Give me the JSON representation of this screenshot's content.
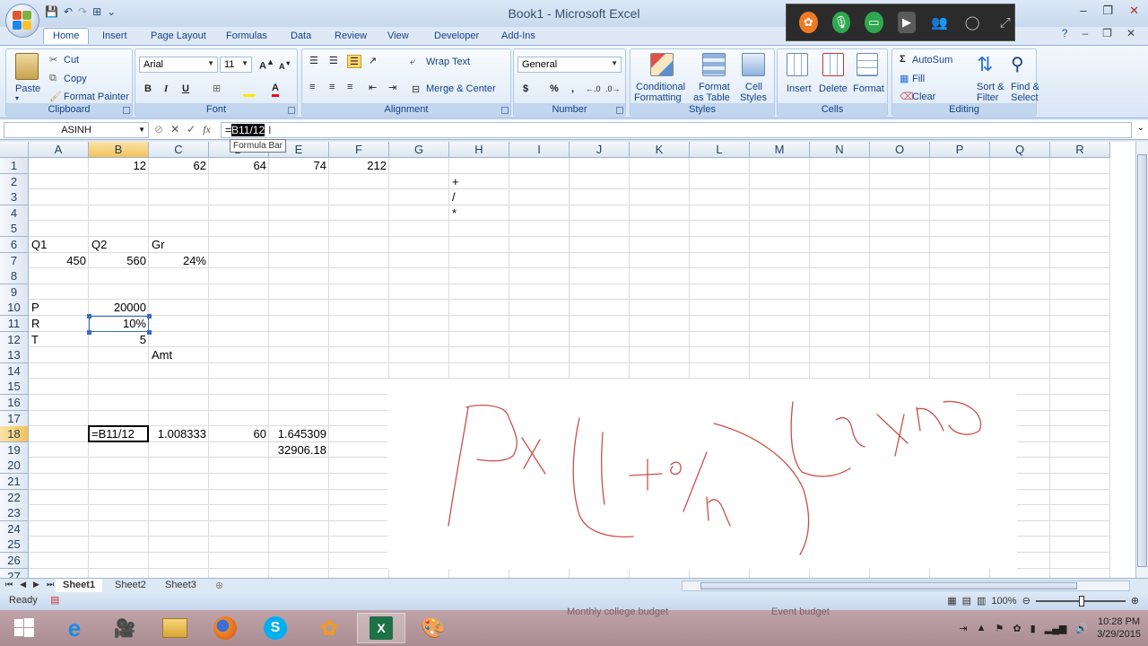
{
  "app": {
    "title": "Book1 - Microsoft Excel",
    "qat_icons": [
      "save-icon",
      "undo-icon",
      "redo-icon",
      "table-icon",
      "customize-icon"
    ]
  },
  "toolbar_overlay": {
    "icons": [
      "app-orange-icon",
      "microphone-icon",
      "screen-share-icon",
      "camera-icon",
      "people-icon",
      "chat-icon",
      "expand-icon"
    ]
  },
  "tabs": [
    "Home",
    "Insert",
    "Page Layout",
    "Formulas",
    "Data",
    "Review",
    "View",
    "Developer",
    "Add-Ins"
  ],
  "ribbon": {
    "clipboard": {
      "label": "Clipboard",
      "paste": "Paste",
      "cut": "Cut",
      "copy": "Copy",
      "format_painter": "Format Painter"
    },
    "font": {
      "label": "Font",
      "font_name": "Arial",
      "font_size": "11",
      "bold": "B",
      "italic": "I",
      "underline": "U"
    },
    "alignment": {
      "label": "Alignment",
      "wrap_text": "Wrap Text",
      "merge_center": "Merge & Center"
    },
    "number": {
      "label": "Number",
      "format": "General",
      "currency": "$",
      "percent": "%",
      "comma": ","
    },
    "styles": {
      "label": "Styles",
      "conditional_1": "Conditional",
      "conditional_2": "Formatting",
      "format_table_1": "Format",
      "format_table_2": "as Table",
      "cell_styles_1": "Cell",
      "cell_styles_2": "Styles"
    },
    "cells": {
      "label": "Cells",
      "insert": "Insert",
      "delete": "Delete",
      "format": "Format"
    },
    "editing": {
      "label": "Editing",
      "autosum": "AutoSum",
      "fill": "Fill",
      "clear": "Clear",
      "sort_1": "Sort &",
      "sort_2": "Filter",
      "find_1": "Find &",
      "find_2": "Select"
    }
  },
  "formula_bar": {
    "name_box": "ASINH",
    "prefix": "=",
    "highlighted": "B11/12",
    "tooltip": "Formula Bar"
  },
  "columns": [
    "A",
    "B",
    "C",
    "D",
    "E",
    "F",
    "G",
    "H",
    "I",
    "J",
    "K",
    "L",
    "M",
    "N",
    "O",
    "P",
    "Q",
    "R"
  ],
  "rows": [
    "1",
    "2",
    "3",
    "4",
    "5",
    "6",
    "7",
    "8",
    "9",
    "10",
    "11",
    "12",
    "13",
    "14",
    "15",
    "16",
    "17",
    "18",
    "19",
    "20",
    "21",
    "22",
    "23",
    "24",
    "25",
    "26",
    "27"
  ],
  "cells": {
    "B1": "12",
    "C1": "62",
    "D1": "64",
    "E1": "74",
    "F1": "212",
    "H2": "+",
    "H3": "/",
    "H4": "*",
    "A6": "Q1",
    "B6": "Q2",
    "C6": "Gr",
    "A7": "450",
    "B7": "560",
    "C7": "24%",
    "A10": "P",
    "B10": "20000",
    "A11": "R",
    "B11": "10%",
    "A12": "T",
    "B12": "5",
    "C13": "Amt",
    "B18": "=B11/12",
    "C18": "1.008333",
    "D18": "60",
    "E18": "1.645309",
    "E19": "32906.18"
  },
  "sheets": [
    "Sheet1",
    "Sheet2",
    "Sheet3"
  ],
  "status": {
    "ready": "Ready",
    "zoom": "100%"
  },
  "taskbar": {
    "apps": [
      "windows-start-icon",
      "internet-explorer-icon",
      "camera-app-icon",
      "file-explorer-icon",
      "firefox-icon",
      "skype-icon",
      "flower-app-icon",
      "excel-icon",
      "paint-icon"
    ],
    "ghost_1": "Monthly college budget",
    "ghost_2": "Event budget",
    "time": "10:28 PM",
    "date": "3/29/2015"
  },
  "colors": {
    "accent": "#15428b",
    "selection": "#f2c25a",
    "ink": "#c8504a",
    "excel_green": "#1e7145"
  }
}
